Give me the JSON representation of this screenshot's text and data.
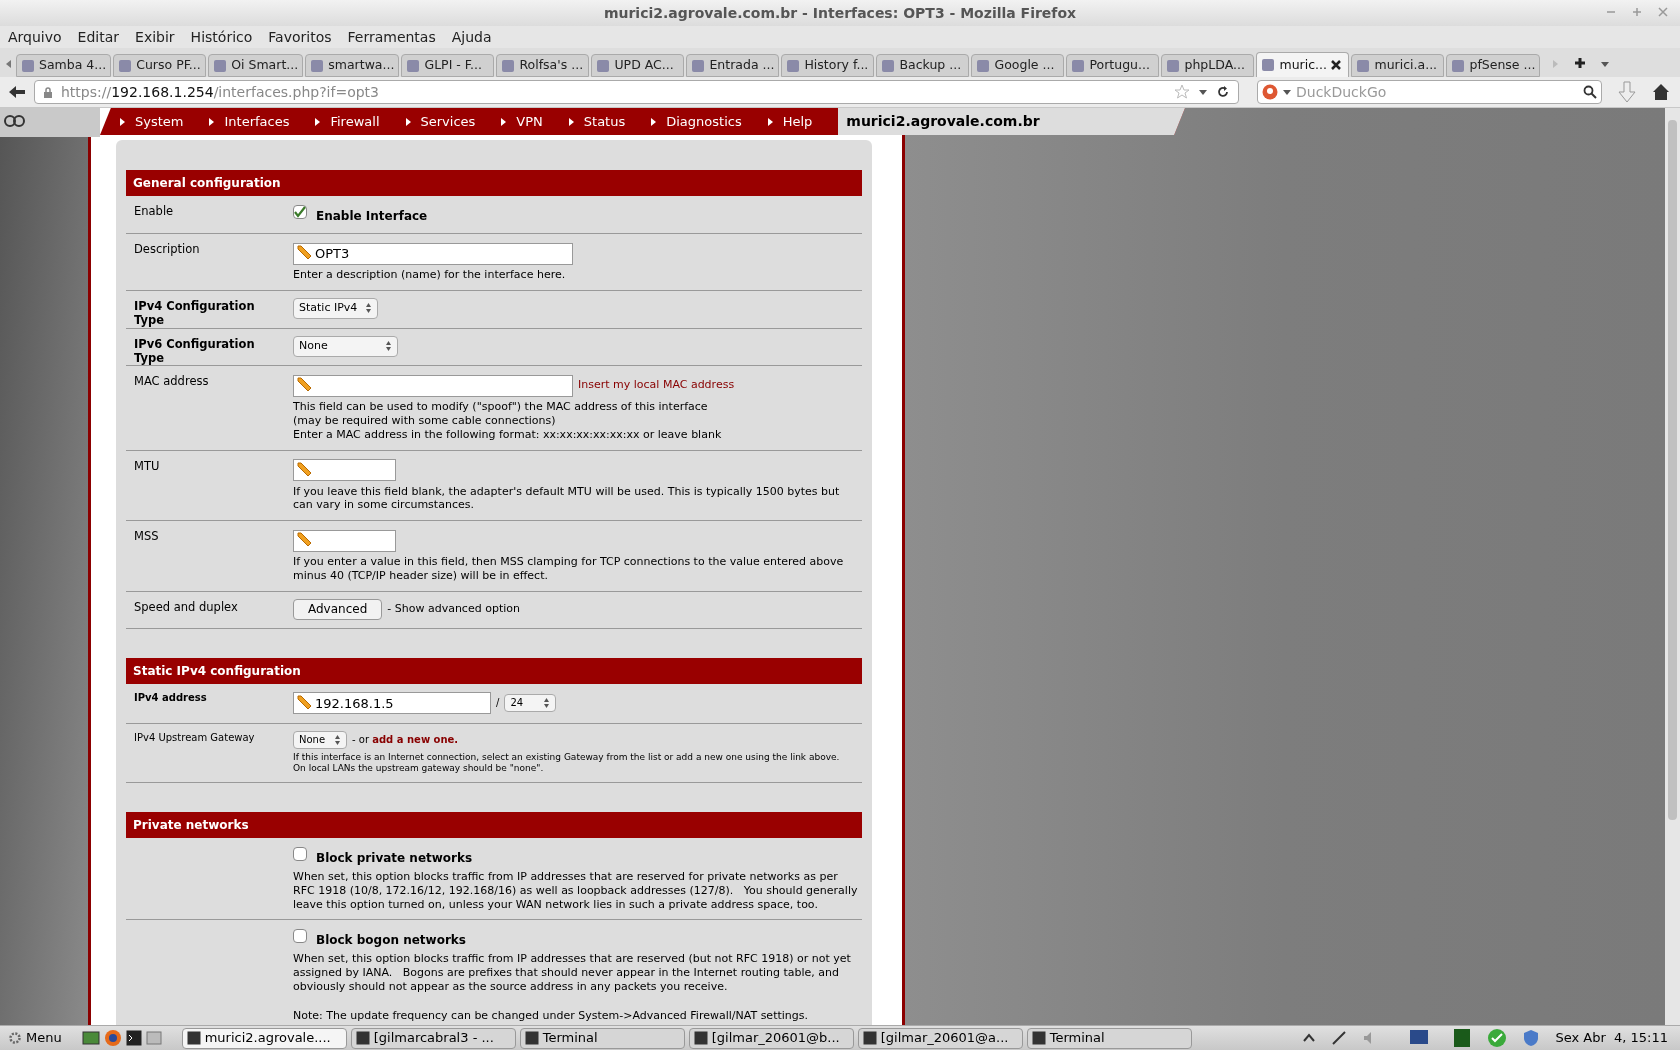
{
  "window": {
    "title": "murici2.agrovale.com.br - Interfaces: OPT3 - Mozilla Firefox"
  },
  "menu_bar": [
    "Arquivo",
    "Editar",
    "Exibir",
    "Histórico",
    "Favoritos",
    "Ferramentas",
    "Ajuda"
  ],
  "tabs": [
    {
      "label": "Samba 4...",
      "selected": false
    },
    {
      "label": "Curso PF...",
      "selected": false
    },
    {
      "label": "Oi Smart...",
      "selected": false
    },
    {
      "label": "smartwa...",
      "selected": false
    },
    {
      "label": "GLPI - F...",
      "selected": false
    },
    {
      "label": "Rolfsa's ...",
      "selected": false
    },
    {
      "label": "UPD AC...",
      "selected": false
    },
    {
      "label": "Entrada ...",
      "selected": false
    },
    {
      "label": "History f...",
      "selected": false
    },
    {
      "label": "Backup ...",
      "selected": false
    },
    {
      "label": "Google ...",
      "selected": false
    },
    {
      "label": "Portugu...",
      "selected": false
    },
    {
      "label": "phpLDA...",
      "selected": false
    },
    {
      "label": "muric...",
      "selected": true
    },
    {
      "label": "murici.a...",
      "selected": false
    },
    {
      "label": "pfSense ...",
      "selected": false
    }
  ],
  "address_bar": {
    "scheme": "https://",
    "host": "192.168.1.254",
    "path": "/interfaces.php?if=opt3"
  },
  "search_bar": {
    "placeholder": "DuckDuckGo"
  },
  "nav": {
    "items": [
      "System",
      "Interfaces",
      "Firewall",
      "Services",
      "VPN",
      "Status",
      "Diagnostics",
      "Help"
    ],
    "hostname": "murici2.agrovale.com.br"
  },
  "sections": [
    {
      "title": "General configuration",
      "rows": [
        {
          "label": "Enable",
          "bold": false,
          "controls": [
            {
              "kind": "checkbox",
              "checked": true,
              "text": "Enable Interface"
            }
          ]
        },
        {
          "label": "Description",
          "bold": false,
          "controls": [
            {
              "kind": "input",
              "value": "OPT3"
            }
          ],
          "help": [
            "Enter a description (name) for the interface here."
          ]
        },
        {
          "label": "IPv4 Configuration Type",
          "bold": true,
          "controls": [
            {
              "kind": "select",
              "value": "Static IPv4"
            }
          ]
        },
        {
          "label": "IPv6 Configuration Type",
          "bold": true,
          "controls": [
            {
              "kind": "select",
              "value": "None"
            }
          ]
        },
        {
          "label": "MAC address",
          "bold": false,
          "controls": [
            {
              "kind": "input"
            },
            {
              "kind": "link",
              "text": "Insert my local MAC address"
            }
          ],
          "help": [
            "This field can be used to modify (\"spoof\") the MAC address of this interface",
            "(may be required with some cable connections)",
            "Enter a MAC address in the following format: xx:xx:xx:xx:xx:xx or leave blank"
          ]
        },
        {
          "label": "MTU",
          "bold": false,
          "controls": [
            {
              "kind": "input"
            }
          ],
          "help": [
            "If you leave this field blank, the adapter's default MTU will be used. This is typically 1500 bytes but can vary in some circumstances."
          ]
        },
        {
          "label": "MSS",
          "bold": false,
          "controls": [
            {
              "kind": "input"
            }
          ],
          "help": [
            "If you enter a value in this field, then MSS clamping for TCP connections to the value entered above minus 40 (TCP/IP header size) will be in effect."
          ]
        },
        {
          "label": "Speed and duplex",
          "bold": false,
          "controls": [
            {
              "kind": "button",
              "text": "Advanced"
            },
            {
              "kind": "text",
              "text": "- Show advanced option"
            }
          ]
        }
      ]
    },
    {
      "title": "Static IPv4 configuration",
      "rows": [
        {
          "label": "IPv4 address",
          "bold": true,
          "compact": true,
          "controls": [
            {
              "kind": "input",
              "value": "192.168.1.5"
            },
            {
              "kind": "text",
              "text": "/"
            },
            {
              "kind": "select",
              "value": "24"
            }
          ]
        },
        {
          "label": "IPv4 Upstream Gateway",
          "bold": false,
          "compact": true,
          "controls": [
            {
              "kind": "select",
              "value": "None"
            },
            {
              "kind": "text",
              "text": "- or **add a new one.**"
            }
          ],
          "help": [
            "If this interface is an Internet connection, select an existing Gateway from the list or add a new one using the link above.",
            "On local LANs the upstream gateway should be \"none\"."
          ]
        }
      ]
    },
    {
      "title": "Private networks",
      "rows": [
        {
          "controls": [
            {
              "kind": "checkbox",
              "checked": false,
              "text": "Block private networks"
            }
          ],
          "help": [
            "When set, this option blocks traffic from IP addresses that are reserved for private networks as per RFC 1918 (10/8, 172.16/12, 192.168/16) as well as loopback addresses (127/8).   You should generally leave this option turned on, unless your WAN network lies in such a private address space, too."
          ]
        },
        {
          "controls": [
            {
              "kind": "checkbox",
              "checked": false,
              "text": "Block bogon networks"
            }
          ],
          "help": [
            "When set, this option blocks traffic from IP addresses that are reserved (but not RFC 1918) or not yet assigned by IANA.   Bogons are prefixes that should never appear in the Internet routing table, and obviously should not appear as the source address in any packets you receive."
          ],
          "note": "Note: The update frequency can be changed under System->Advanced Firewall/NAT settings."
        }
      ]
    }
  ],
  "taskbar": {
    "menu": "Menu",
    "tasks": [
      {
        "label": "murici2.agrovale....",
        "selected": true
      },
      {
        "label": "[gilmarcabral3 - ...",
        "selected": false
      },
      {
        "label": "Terminal",
        "selected": false
      },
      {
        "label": "[gilmar_20601@b...",
        "selected": false
      },
      {
        "label": "[gilmar_20601@a...",
        "selected": false
      },
      {
        "label": "Terminal",
        "selected": false
      }
    ],
    "clock": "Sex Abr  4, 15:11"
  }
}
